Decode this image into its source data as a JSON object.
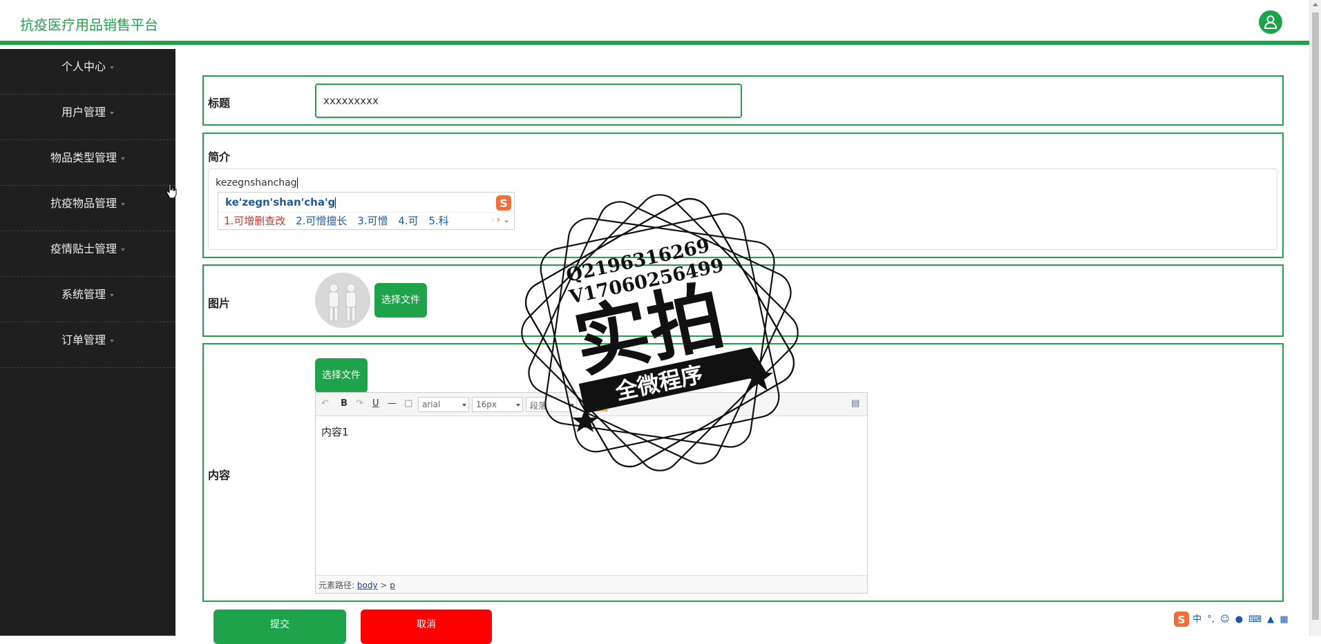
{
  "app": {
    "title": "抗疫医疗用品销售平台"
  },
  "sidebar": {
    "items": [
      {
        "label": "个人中心"
      },
      {
        "label": "用户管理"
      },
      {
        "label": "物品类型管理"
      },
      {
        "label": "抗疫物品管理"
      },
      {
        "label": "疫情贴士管理"
      },
      {
        "label": "系统管理"
      },
      {
        "label": "订单管理"
      }
    ]
  },
  "form": {
    "title_label": "标题",
    "title_value": "xxxxxxxxx",
    "intro_label": "简介",
    "intro_value": "kezegnshanchag",
    "image_label": "图片",
    "image_button": "选择文件",
    "content_label": "内容",
    "content_button": "选择文件",
    "submit": "提交",
    "cancel": "取消"
  },
  "ime": {
    "pinyin": "ke'zegn'shan'cha'g",
    "candidates": [
      "1.可增删查改",
      "2.可憎擅长",
      "3.可憎",
      "4.可",
      "5.科"
    ]
  },
  "editor": {
    "font_family": "arial",
    "font_size": "16px",
    "paragraph": "段落",
    "content": "内容1",
    "path_label": "元素路径:",
    "path_body": "body",
    "path_sep": ">",
    "path_p": "p"
  },
  "watermark": {
    "line1": "Q2196316269",
    "line2": "V17060256499",
    "big": "实拍",
    "banner": "全微程序"
  },
  "tray": {
    "lang": "中"
  },
  "colors": {
    "accent": "#1fa34a",
    "sidebar": "#1f1f1f",
    "cancel": "#ff0000"
  }
}
